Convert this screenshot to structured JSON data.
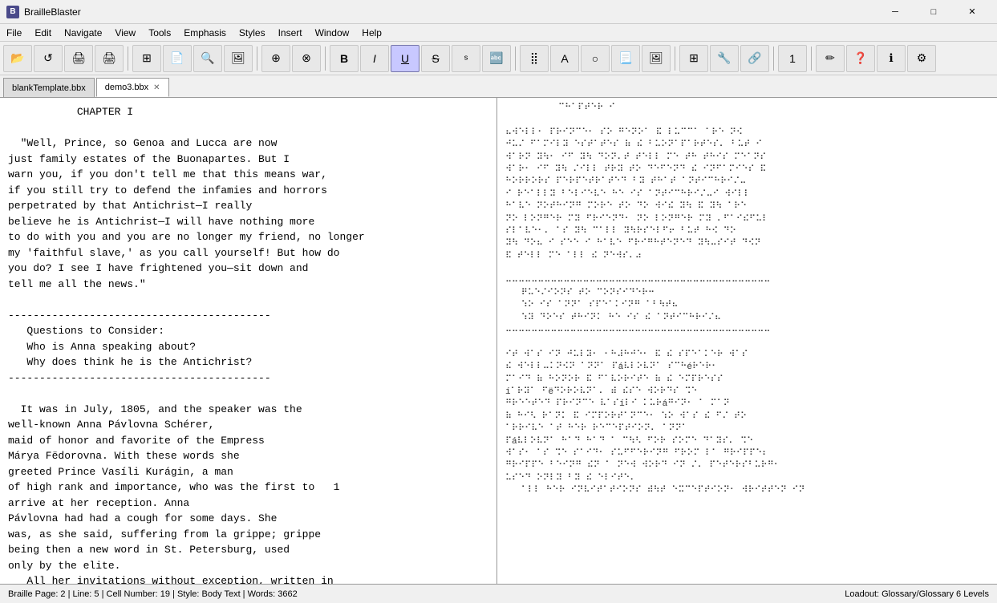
{
  "titlebar": {
    "title": "BrailleBlaster",
    "icon_label": "B",
    "minimize_label": "─",
    "maximize_label": "□",
    "close_label": "✕"
  },
  "menubar": {
    "items": [
      "File",
      "Edit",
      "Navigate",
      "View",
      "Tools",
      "Emphasis",
      "Styles",
      "Insert",
      "Window",
      "Help"
    ]
  },
  "toolbar": {
    "buttons": [
      {
        "name": "open",
        "icon": "📂"
      },
      {
        "name": "reload",
        "icon": "↺"
      },
      {
        "name": "print",
        "icon": "🖨"
      },
      {
        "name": "print2",
        "icon": "🖨"
      },
      {
        "name": "table",
        "icon": "⊞"
      },
      {
        "name": "export",
        "icon": "📄"
      },
      {
        "name": "search",
        "icon": "🔍"
      },
      {
        "name": "image",
        "icon": "🖼"
      },
      {
        "name": "tool1",
        "icon": "⊕"
      },
      {
        "name": "tool2",
        "icon": "⊗"
      },
      {
        "name": "bold-icon",
        "icon": "B"
      },
      {
        "name": "italic-icon",
        "icon": "I"
      },
      {
        "name": "underline-icon",
        "icon": "U"
      },
      {
        "name": "strike-icon",
        "icon": "S"
      },
      {
        "name": "script-icon",
        "icon": "ˢ"
      },
      {
        "name": "format-icon",
        "icon": "🔤"
      },
      {
        "name": "braille-icon",
        "icon": "⣿"
      },
      {
        "name": "font-icon",
        "icon": "A"
      },
      {
        "name": "shape-icon",
        "icon": "○"
      },
      {
        "name": "page-icon",
        "icon": "📃"
      },
      {
        "name": "img2-icon",
        "icon": "🖼"
      },
      {
        "name": "tool3",
        "icon": "⊞"
      },
      {
        "name": "tool4",
        "icon": "🔧"
      },
      {
        "name": "tool5",
        "icon": "🔗"
      },
      {
        "name": "num-icon",
        "icon": "1"
      },
      {
        "name": "pen-icon",
        "icon": "✏"
      },
      {
        "name": "help2-icon",
        "icon": "?"
      },
      {
        "name": "info-icon",
        "icon": "ℹ"
      },
      {
        "name": "settings2-icon",
        "icon": "⚙"
      }
    ]
  },
  "tabs": [
    {
      "label": "blankTemplate.bbx",
      "closeable": false,
      "active": false
    },
    {
      "label": "demo3.bbx",
      "closeable": true,
      "active": true
    }
  ],
  "text_panel": {
    "content": "           CHAPTER I\n\n  \"Well, Prince, so Genoa and Lucca are now\njust family estates of the Buonapartes. But I\nwarn you, if you don't tell me that this means war,\nif you still try to defend the infamies and horrors\nperpetrated by that Antichrist—I really\nbelieve he is Antichrist—I will have nothing more\nto do with you and you are no longer my friend, no longer\nmy 'faithful slave,' as you call yourself! But how do\nyou do? I see I have frightened you—sit down and\ntell me all the news.\"\n\n------------------------------------------\n   Questions to Consider:\n   Who is Anna speaking about?\n   Why does think he is the Antichrist?\n------------------------------------------\n\n  It was in July, 1805, and the speaker was the\nwell-known Anna Pávlovna Schérer,\nmaid of honor and favorite of the Empress\nMárya Fëdorovna. With these words she\ngreeted Prince Vasíli Kurágin, a man\nof high rank and importance, who was the first to\narrive at her reception. Anna\nPávlovna had had a cough for some days. She\nwas, as she said, suffering from la grippe; grippe\nbeing then a new word in St. Petersburg, used\nonly by the elite.\n   All her invitations without exception, written in"
  },
  "page_number": "1",
  "braille_panel": {
    "content": "          ⠉⠓⠁⠏⠞⠑⠗ ⠊\n\n⠦⠺⠑⠇⠇⠂ ⠏⠗⠊⠝⠉⠑⠂ ⠎⠕ ⠛⠑⠝⠕⠁ ⠯ ⠇⠥⠉⠉⠁ ⠁⠗⠑ ⠝⠪\n⠚⠥⠌ ⠋⠁⠍⠊⠇⠽ ⠑⠎⠞⠁⠞⠑⠎ ⠷ ⠮ ⠃⠥⠕⠝⠁⠏⠁⠗⠞⠑⠎⠄ ⠃⠥⠞ ⠊\n⠺⠁⠗⠝ ⠽⠳⠂ ⠊⠋ ⠽⠳ ⠙⠕⠝⠄⠞ ⠞⠑⠇⠇ ⠍⠑ ⠞⠓ ⠞⠓⠊⠎ ⠍⠑⠁⠝⠎\n⠺⠁⠗⠂ ⠊⠋ ⠽⠳ ⠌⠊⠇⠇ ⠞⠗⠽ ⠞⠕ ⠙⠑⠋⠑⠝⠙ ⠮ ⠊⠝⠋⠁⠍⠊⠑⠎ ⠯\n⠓⠕⠗⠗⠕⠗⠎ ⠏⠑⠗⠏⠑⠞⠗⠁⠞⠑⠙ ⠃⠽ ⠞⠓⠁⠞ ⠁⠝⠞⠊⠉⠓⠗⠊⠌⠤\n⠊ ⠗⠑⠁⠇⠇⠽ ⠃⠑⠇⠊⠑⠧⠑ ⠓⠑ ⠊⠎ ⠁⠝⠞⠊⠉⠓⠗⠊⠌⠤⠊ ⠺⠊⠇⠇\n⠓⠁⠧⠑ ⠝⠕⠞⠓⠊⠝⠛ ⠍⠕⠗⠑ ⠞⠕ ⠙⠕ ⠺⠊⠮ ⠽⠳ ⠯ ⠽⠳ ⠁⠗⠑\n⠝⠕ ⠇⠕⠝⠛⠑⠗ ⠍⠽ ⠋⠗⠊⠑⠝⠙⠂ ⠝⠕ ⠇⠕⠝⠛⠑⠗ ⠍⠽ ⠄⠋⠁⠊⠮⠋⠥⠇\n⠎⠇⠁⠧⠑⠂⠄ ⠁⠎ ⠽⠳ ⠉⠁⠇⠇ ⠽⠳⠗⠎⠑⠇⠋⠖ ⠃⠥⠞ ⠓⠪ ⠙⠕\n⠽⠳ ⠙⠕⠦ ⠊ ⠎⠑⠑ ⠊ ⠓⠁⠧⠑ ⠋⠗⠊⠛⠓⠞⠑⠝⠑⠙ ⠽⠳⠤⠎⠊⠞ ⠙⠪⠝\n⠯ ⠞⠑⠇⠇ ⠍⠑ ⠁⠇⠇ ⠮ ⠝⠑⠺⠎⠄⠴\n\n⠤⠤⠤⠤⠤⠤⠤⠤⠤⠤⠤⠤⠤⠤⠤⠤⠤⠤⠤⠤⠤⠤⠤⠤⠤⠤⠤⠤⠤⠤⠤⠤⠤⠤⠤⠤⠤⠤⠤⠤⠤\n   ⠟⠥⠑⠌⠊⠕⠝⠎ ⠞⠕ ⠉⠕⠝⠎⠊⠙⠑⠗⠒\n   ⠱⠕ ⠊⠎ ⠁⠝⠝⠁ ⠎⠏⠑⠁⠅⠊⠝⠛ ⠁⠃⠳⠞⠦\n   ⠱⠽ ⠙⠕⠑⠎ ⠞⠓⠊⠝⠅ ⠓⠑ ⠊⠎ ⠮ ⠁⠝⠞⠊⠉⠓⠗⠊⠌⠦\n⠤⠤⠤⠤⠤⠤⠤⠤⠤⠤⠤⠤⠤⠤⠤⠤⠤⠤⠤⠤⠤⠤⠤⠤⠤⠤⠤⠤⠤⠤⠤⠤⠤⠤⠤⠤⠤⠤⠤⠤⠤\n\n⠊⠞ ⠺⠁⠎ ⠊⠝ ⠚⠥⠇⠽⠂ ⠂⠓⠼⠓⠚⠑⠂ ⠯ ⠮ ⠎⠏⠑⠁⠅⠑⠗ ⠺⠁⠎\n⠮ ⠺⠑⠇⠇⠤⠅⠝⠪⠝ ⠁⠝⠝⠁ ⠏á⠧⠇⠕⠧⠝⠁ ⠎⠉⠓é⠗⠑⠗⠂\n⠍⠁⠊⠙ ⠷ ⠓⠕⠝⠕⠗ ⠯ ⠋⠁⠧⠕⠗⠊⠞⠑ ⠷ ⠮ ⠑⠍⠏⠗⠑⠎⠎\ní⠁⠗⠽⠁ ⠋ë⠙⠕⠗⠕⠧⠝⠁⠄ ⠾ ⠮⠎⠑ ⠺⠕⠗⠙⠎ ⠩⠑\n⠛⠗⠑⠑⠞⠑⠙ ⠏⠗⠊⠝⠉⠑ ⠧⠁⠎í⠇⠊ ⠅⠥⠗á⠛⠊⠝⠂ ⠁ ⠍⠁⠝\n⠷ ⠓⠊⠣ ⠗⠁⠝⠅ ⠯ ⠊⠍⠏⠕⠗⠞⠁⠝⠉⠑⠂ ⠱⠕ ⠺⠁⠎ ⠮ ⠋⠌ ⠞⠕\n⠁⠗⠗⠊⠧⠑ ⠁⠞ ⠓⠑⠗ ⠗⠑⠉⠑⠏⠞⠊⠕⠝⠄ ⠁⠝⠝⠁\n⠏á⠧⠇⠕⠧⠝⠁ ⠓⠁⠙ ⠓⠁⠙ ⠁ ⠉⠳⠣ ⠋⠕⠗ ⠎⠕⠍⠑ ⠙⠁⠽⠎⠄ ⠩⠑\n⠺⠁⠎⠂ ⠁⠎ ⠩⠑ ⠎⠁⠊⠙⠂ ⠎⠥⠋⠋⠑⠗⠊⠝⠛ ⠋⠗⠕⠍ ⠇⠁ ⠛⠗⠊⠏⠏⠑⠆\n⠛⠗⠊⠏⠏⠑ ⠃⠑⠊⠝⠛ ⠮⠝ ⠁ ⠝⠑⠺ ⠺⠕⠗⠙ ⠊⠝ ⠌⠄ ⠏⠑⠞⠑⠗⠎⠃⠥⠗⠛⠂\n⠥⠎⠑⠙ ⠕⠝⠇⠽ ⠃⠽ ⠮ ⠑⠇⠊⠞⠑⠄\n   ⠁⠇⠇ ⠓⠑⠗ ⠊⠝⠧⠊⠞⠁⠞⠊⠕⠝⠎ ⠾⠳⠞ ⠑⠭⠉⠑⠏⠞⠊⠕⠝⠂ ⠺⠗⠊⠞⠞⠑⠝ ⠊⠝"
  },
  "statusbar": {
    "left": "Braille Page: 2 | Line: 5 | Cell Number: 19 | Style: Body Text | Words: 3662",
    "right": "Loadout: Glossary/Glossary 6 Levels"
  }
}
